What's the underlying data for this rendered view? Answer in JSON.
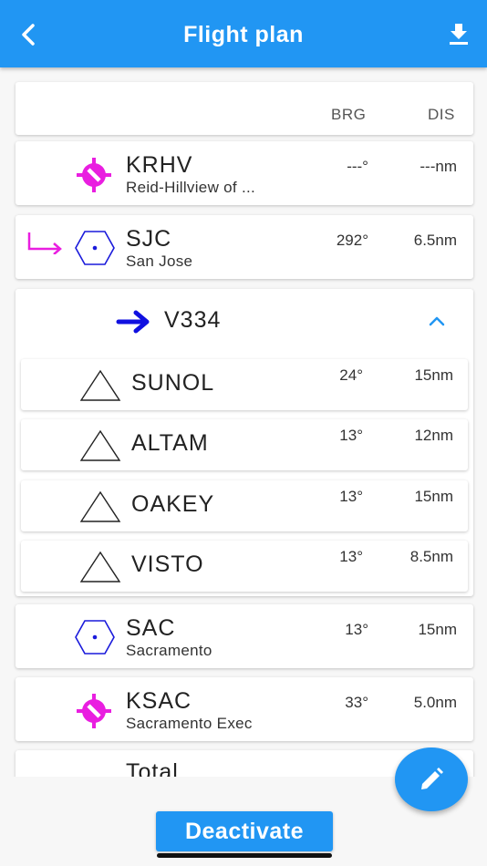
{
  "header": {
    "title": "Flight plan",
    "back_icon": "back-chevron-icon",
    "download_icon": "download-icon"
  },
  "columns": {
    "brg": "BRG",
    "dis": "DIS"
  },
  "waypoints": [
    {
      "ident": "KRHV",
      "name": "Reid-Hillview of ...",
      "brg": "---°",
      "dis": "---nm",
      "icon": "airport-icon",
      "color": "#e91ee0"
    },
    {
      "ident": "SJC",
      "name": "San Jose",
      "brg": "292°",
      "dis": "6.5nm",
      "icon": "vor-icon",
      "color": "#1a1adb"
    }
  ],
  "airway": {
    "name": "V334",
    "icon": "arrow-right-icon",
    "expanded": true,
    "fixes": [
      {
        "ident": "SUNOL",
        "brg": "24°",
        "dis": "15nm"
      },
      {
        "ident": "ALTAM",
        "brg": "13°",
        "dis": "12nm"
      },
      {
        "ident": "OAKEY",
        "brg": "13°",
        "dis": "15nm"
      },
      {
        "ident": "VISTO",
        "brg": "13°",
        "dis": "8.5nm"
      }
    ]
  },
  "after_airway": [
    {
      "ident": "SAC",
      "name": "Sacramento",
      "brg": "13°",
      "dis": "15nm",
      "icon": "vor-icon"
    },
    {
      "ident": "KSAC",
      "name": "Sacramento Exec",
      "brg": "33°",
      "dis": "5.0nm",
      "icon": "airport-icon"
    }
  ],
  "total_label": "Total",
  "fab_icon": "edit-pencil-icon",
  "deactivate_label": "Deactivate",
  "colors": {
    "accent": "#2196f3",
    "airport": "#e91ee0",
    "navaid": "#1a1adb"
  }
}
